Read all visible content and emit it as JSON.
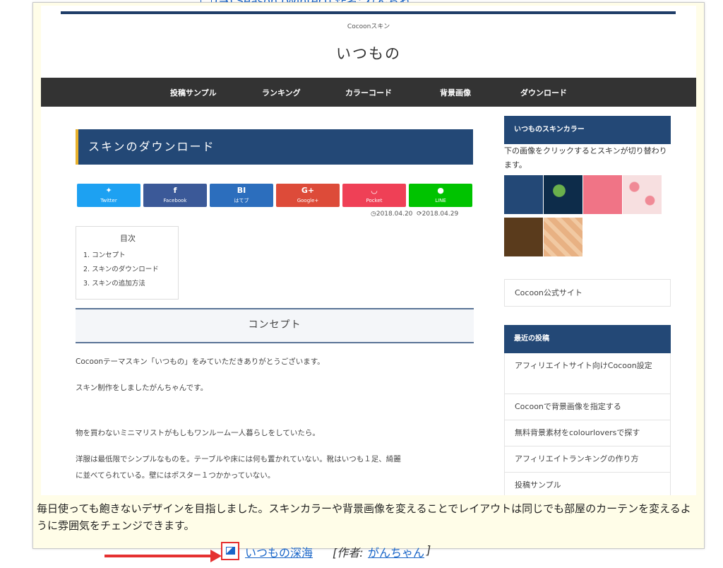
{
  "top_link": {
    "text": "(→) Season (Winter)] 作者: れんちゃ"
  },
  "site": {
    "skin_label": "Cocoonスキン",
    "title": "いつもの"
  },
  "nav": {
    "items": [
      "投稿サンプル",
      "ランキング",
      "カラーコード",
      "背景画像",
      "ダウンロード"
    ]
  },
  "post": {
    "title": "スキンのダウンロード",
    "share": [
      {
        "icon": "twitter-icon",
        "glyph": "🐦",
        "label": "Twitter",
        "color": "#1da1f2"
      },
      {
        "icon": "facebook-icon",
        "glyph": "f",
        "label": "Facebook",
        "color": "#3b5998"
      },
      {
        "icon": "hatena-icon",
        "glyph": "BI",
        "label": "はてブ",
        "color": "#2c6ebd"
      },
      {
        "icon": "googleplus-icon",
        "glyph": "G+",
        "label": "Google+",
        "color": "#dd4b39"
      },
      {
        "icon": "pocket-icon",
        "glyph": "◡",
        "label": "Pocket",
        "color": "#ef4056"
      },
      {
        "icon": "line-icon",
        "glyph": "●",
        "label": "LINE",
        "color": "#00c300"
      }
    ],
    "date_published": "2018.04.20",
    "date_updated": "2018.04.29",
    "toc": {
      "title": "目次",
      "items": [
        "1. コンセプト",
        "2. スキンのダウンロード",
        "3. スキンの追加方法"
      ]
    },
    "section_heading": "コンセプト",
    "paragraphs": [
      "Cocoonテーマスキン「いつもの」をみていただきありがとうございます。",
      "スキン制作をしましたがんちゃんです。",
      "物を買わないミニマリストがもしもワンルーム一人暮らしをしていたら。",
      "洋服は最低限でシンプルなものを。テーブルや床には何も置かれていない。靴はいつも１足、綺麗",
      "に並べてられている。壁にはポスター１つかかっていない。"
    ]
  },
  "sidebar": {
    "skin_color_title": "いつものスキンカラー",
    "skin_color_desc": "下の画像をクリックするとスキンが切り替わります。",
    "swatch_colors": [
      "#234876",
      "#0d2c4a",
      "#f07486",
      "#f7dfe0",
      "#5a3b1c",
      "#e8b183"
    ],
    "cocoon_link": "Cocoon公式サイト",
    "recent_title": "最近の投稿",
    "recent": [
      "アフィリエイトサイト向けCocoon設定",
      "Cocoonで背景画像を指定する",
      "無料背景素材をcolourloversで探す",
      "アフィリエイトランキングの作り方",
      "投稿サンプル"
    ]
  },
  "caption": "毎日使っても飽きないデザインを目指しました。スキンカラーや背景画像を変えることでレイアウトは同じでも部屋のカーテンを変えるように雰囲気をチェンジできます。",
  "bottom": {
    "link_text": "いつもの深海",
    "author_label": "[作者: ",
    "author": "がんちゃん",
    "closing_bracket": "]"
  }
}
